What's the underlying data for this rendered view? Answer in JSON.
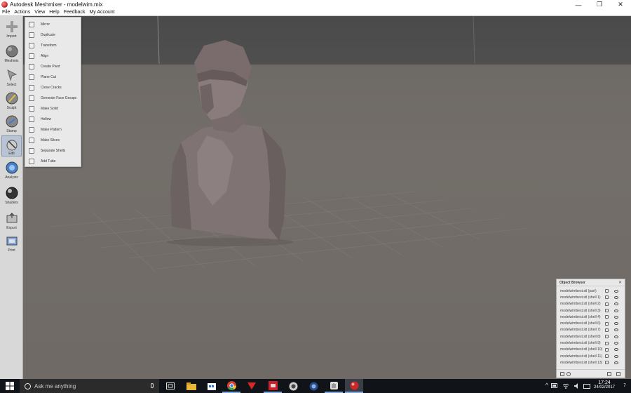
{
  "window": {
    "title": "Autodesk Meshmixer - modelwim.mix",
    "minimize": "—",
    "maximize": "❐",
    "close": "✕"
  },
  "menubar": [
    "File",
    "Actions",
    "View",
    "Help",
    "Feedback",
    "My Account"
  ],
  "toolbar": [
    {
      "label": "Import",
      "icon": "plus-icon"
    },
    {
      "label": "Meshmix",
      "icon": "meshmix-sphere-icon"
    },
    {
      "label": "Select",
      "icon": "select-arrow-icon"
    },
    {
      "label": "Sculpt",
      "icon": "sculpt-brush-icon"
    },
    {
      "label": "Stamp",
      "icon": "stamp-icon"
    },
    {
      "label": "Edit",
      "icon": "edit-icon",
      "active": true
    },
    {
      "label": "Analysis",
      "icon": "analysis-icon"
    },
    {
      "label": "Shaders",
      "icon": "shaders-sphere-icon"
    },
    {
      "label": "Export",
      "icon": "export-icon"
    },
    {
      "label": "Print",
      "icon": "print-icon"
    }
  ],
  "edit_menu": [
    "Mirror",
    "Duplicate",
    "Transform",
    "Align",
    "Create Pivot",
    "Plane Cut",
    "Close Cracks",
    "Generate Face Groups",
    "Make Solid",
    "Hollow",
    "Make Pattern",
    "Make Slices",
    "Separate Shells",
    "Add Tube"
  ],
  "object_browser": {
    "title": "Object Browser",
    "close": "✕",
    "items": [
      "modelwimbest.stl (part)",
      "modelwimbest.stl (shell 1)",
      "modelwimbest.stl (shell 2)",
      "modelwimbest.stl (shell 3)",
      "modelwimbest.stl (shell 4)",
      "modelwimbest.stl (shell 6)",
      "modelwimbest.stl (shell 7)",
      "modelwimbest.stl (shell 8)",
      "modelwimbest.stl (shell 9)",
      "modelwimbest.stl (shell 10)",
      "modelwimbest.stl (shell 11)",
      "modelwimbest.stl (shell 13)"
    ]
  },
  "taskbar": {
    "search_placeholder": "Ask me anything",
    "apps": [
      {
        "name": "task-view",
        "icon": "task-view-icon"
      },
      {
        "name": "file-explorer",
        "icon": "folder-icon"
      },
      {
        "name": "store",
        "icon": "store-icon"
      },
      {
        "name": "chrome",
        "icon": "chrome-icon"
      },
      {
        "name": "app-red-arrow",
        "icon": "red-arrow-icon"
      },
      {
        "name": "solidworks",
        "icon": "solidworks-icon"
      },
      {
        "name": "app-swirl",
        "icon": "swirl-icon"
      },
      {
        "name": "app-globe",
        "icon": "globe-icon"
      },
      {
        "name": "app-hand",
        "icon": "hand-icon"
      },
      {
        "name": "meshmixer",
        "icon": "meshmixer-icon"
      }
    ],
    "time": "17:24",
    "date": "24/02/2017",
    "notification_count": "7"
  },
  "colors": {
    "viewport_floor": "#736e69",
    "viewport_top": "#4a4a4a",
    "model": "#8b7e7e",
    "toolbar_bg": "#d8d8d8",
    "taskbar": "#101418",
    "accent": "#7fa8d8"
  }
}
